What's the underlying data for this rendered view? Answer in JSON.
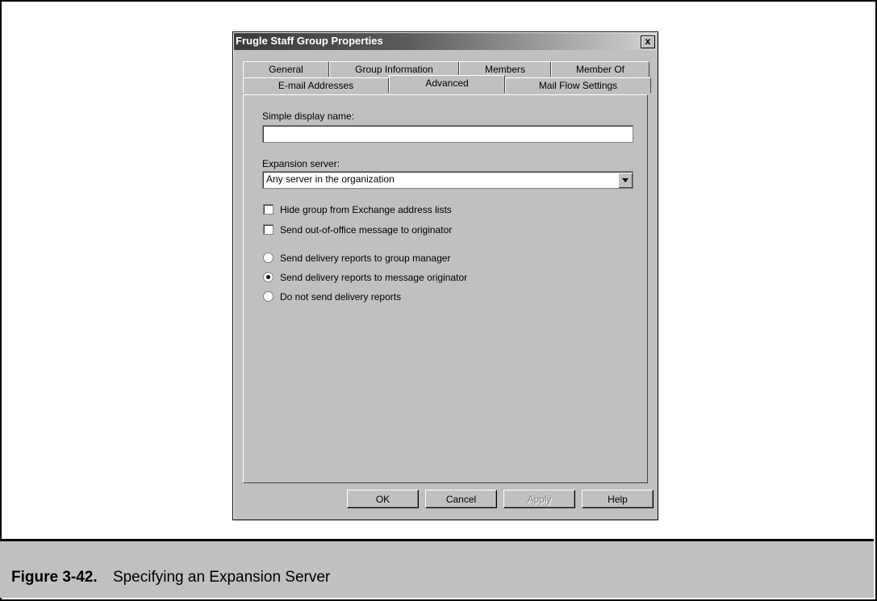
{
  "dialog": {
    "title": "Frugle Staff Group Properties",
    "close_label": "x"
  },
  "tabs_row1": [
    "General",
    "Group Information",
    "Members",
    "Member Of"
  ],
  "tabs_row2": [
    "E-mail Addresses",
    "Advanced",
    "Mail Flow Settings"
  ],
  "active_tab": "Advanced",
  "form": {
    "simple_display_name_label": "Simple display name:",
    "simple_display_name_value": "",
    "expansion_server_label": "Expansion server:",
    "expansion_server_value": "Any server in the organization",
    "hide_group_label": "Hide group from Exchange address lists",
    "hide_group_checked": false,
    "send_ooo_label": "Send out-of-office message to originator",
    "send_ooo_checked": false,
    "radio_group_manager": "Send delivery reports to group manager",
    "radio_message_originator": "Send delivery reports to message originator",
    "radio_no_reports": "Do not send delivery reports",
    "selected_radio": "radio_message_originator"
  },
  "buttons": {
    "ok": "OK",
    "cancel": "Cancel",
    "apply": "Apply",
    "help": "Help"
  },
  "caption": {
    "number": "Figure 3-42.",
    "text": "Specifying an Expansion Server"
  }
}
